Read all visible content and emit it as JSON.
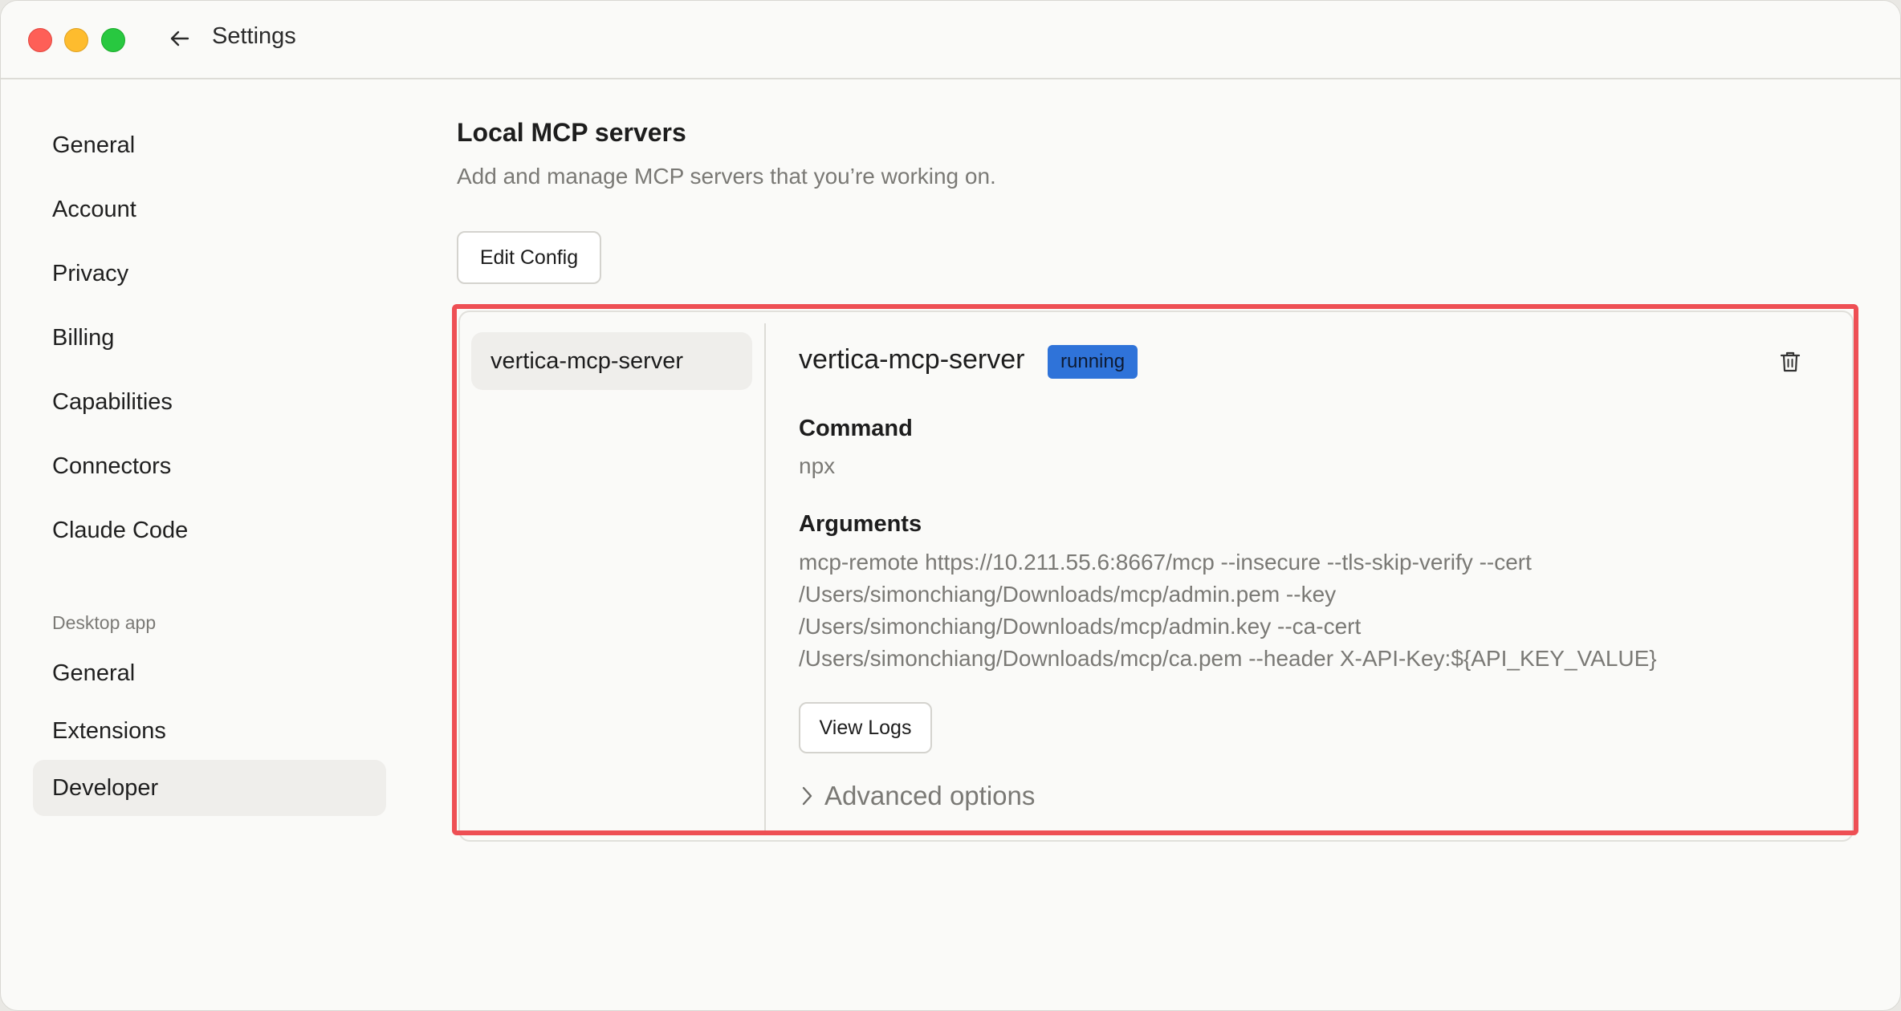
{
  "window": {
    "title": "Settings"
  },
  "sidebar": {
    "items": [
      {
        "label": "General"
      },
      {
        "label": "Account"
      },
      {
        "label": "Privacy"
      },
      {
        "label": "Billing"
      },
      {
        "label": "Capabilities"
      },
      {
        "label": "Connectors"
      },
      {
        "label": "Claude Code"
      }
    ],
    "desktop_section": "Desktop app",
    "desktop_items": [
      {
        "label": "General"
      },
      {
        "label": "Extensions"
      },
      {
        "label": "Developer",
        "active": true
      }
    ]
  },
  "main": {
    "title": "Local MCP servers",
    "subtitle": "Add and manage MCP servers that you’re working on.",
    "edit_config_label": "Edit Config",
    "servers": [
      {
        "name": "vertica-mcp-server"
      }
    ],
    "detail": {
      "name": "vertica-mcp-server",
      "status": "running",
      "command_label": "Command",
      "command": "npx",
      "arguments_label": "Arguments",
      "arguments_lines": [
        "mcp-remote https://10.211.55.6:8667/mcp --insecure --tls-skip-verify --cert",
        "/Users/simonchiang/Downloads/mcp/admin.pem --key",
        "/Users/simonchiang/Downloads/mcp/admin.key --ca-cert",
        "/Users/simonchiang/Downloads/mcp/ca.pem --header X-API-Key:${API_KEY_VALUE}"
      ],
      "view_logs_label": "View Logs",
      "advanced_label": "Advanced options"
    }
  },
  "colors": {
    "status_badge": "#2f73d9",
    "highlight": "#ee4f54",
    "traffic_close": "#fe5f57",
    "traffic_min": "#febc2e",
    "traffic_max": "#28c840"
  },
  "icons": {
    "back": "arrow-left-icon",
    "delete": "trash-icon",
    "expand": "chevron-right-icon"
  }
}
